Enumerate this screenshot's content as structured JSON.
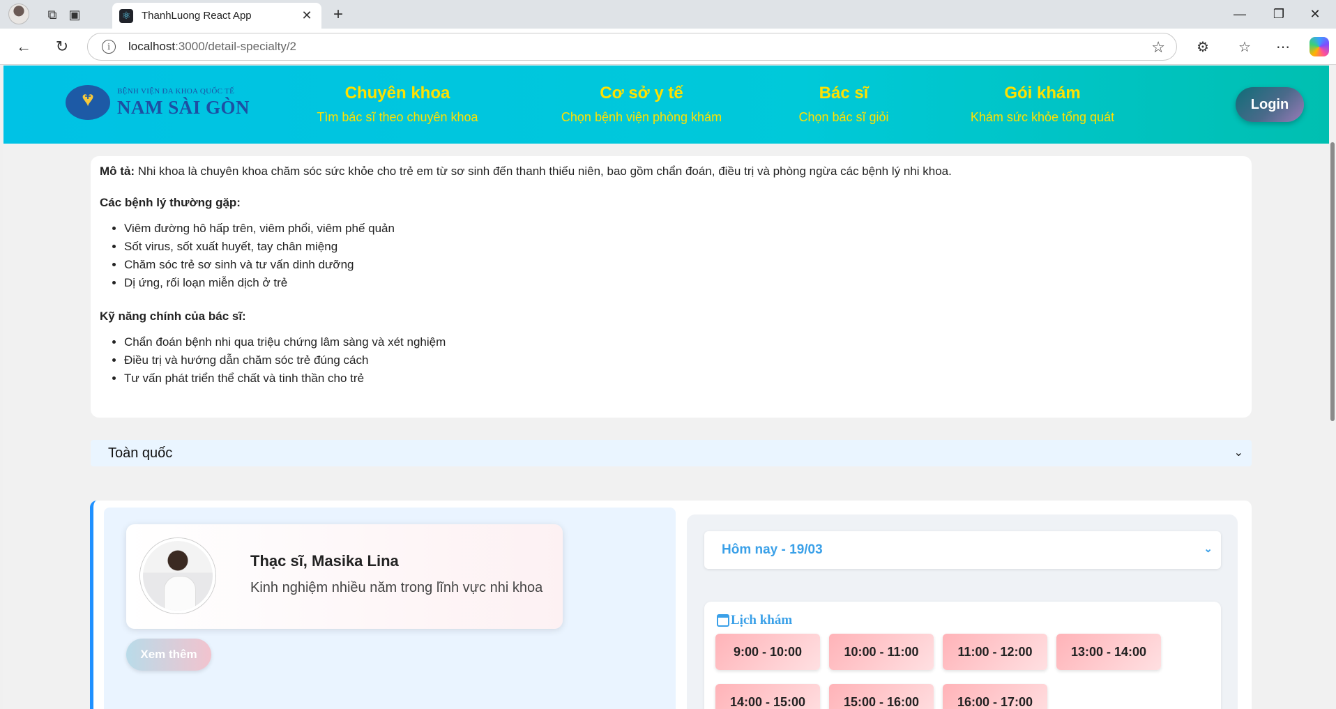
{
  "browser": {
    "tab_title": "ThanhLuong React App",
    "url_host": "localhost",
    "url_path": ":3000/detail-specialty/2"
  },
  "header": {
    "logo_line1": "BỆNH VIỆN ĐA KHOA QUỐC TẾ",
    "logo_line2": "NAM SÀI GÒN",
    "menu": [
      {
        "title": "Chuyên khoa",
        "subtitle": "Tìm bác sĩ theo chuyên khoa"
      },
      {
        "title": "Cơ sở y tế",
        "subtitle": "Chọn bệnh viện phòng khám"
      },
      {
        "title": "Bác sĩ",
        "subtitle": "Chọn bác sĩ giỏi"
      },
      {
        "title": "Gói khám",
        "subtitle": "Khám sức khỏe tổng quát"
      }
    ],
    "login_label": "Login"
  },
  "description": {
    "lead_label": "Mô tả:",
    "lead_text": " Nhi khoa là chuyên khoa chăm sóc sức khỏe cho trẻ em từ sơ sinh đến thanh thiếu niên, bao gồm chẩn đoán, điều trị và phòng ngừa các bệnh lý nhi khoa.",
    "diseases_heading": "Các bệnh lý thường gặp:",
    "diseases": [
      "Viêm đường hô hấp trên, viêm phổi, viêm phế quản",
      "Sốt virus, sốt xuất huyết, tay chân miệng",
      "Chăm sóc trẻ sơ sinh và tư vấn dinh dưỡng",
      "Dị ứng, rối loạn miễn dịch ở trẻ"
    ],
    "skills_heading": "Kỹ năng chính của bác sĩ:",
    "skills": [
      "Chẩn đoán bệnh nhi qua triệu chứng lâm sàng và xét nghiệm",
      "Điều trị và hướng dẫn chăm sóc trẻ đúng cách",
      "Tư vấn phát triển thể chất và tinh thần cho trẻ"
    ]
  },
  "province_select": {
    "value": "Toàn quốc"
  },
  "doctor": {
    "name": "Thạc sĩ, Masika Lina",
    "experience": "Kinh nghiệm nhiều năm trong lĩnh vực nhi khoa",
    "more_label": "Xem thêm"
  },
  "schedule": {
    "date_value": "Hôm nay - 19/03",
    "title": "Lịch khám",
    "slots": [
      "9:00 - 10:00",
      "10:00 - 11:00",
      "11:00 - 12:00",
      "13:00 - 14:00",
      "14:00 - 15:00",
      "15:00 - 16:00",
      "16:00 - 17:00"
    ]
  },
  "colors": {
    "header_gradient_start": "#00c2e5",
    "header_gradient_end": "#00bfb0",
    "menu_text": "#ffe100",
    "accent_blue": "#3aa0e8",
    "slot_pink": "#ffb3b8"
  },
  "icons": [
    "back-icon",
    "reload-icon",
    "info-icon",
    "star-icon",
    "extensions-icon",
    "favorites-icon",
    "more-icon",
    "copilot-icon",
    "calendar-icon",
    "chevron-down-icon"
  ]
}
